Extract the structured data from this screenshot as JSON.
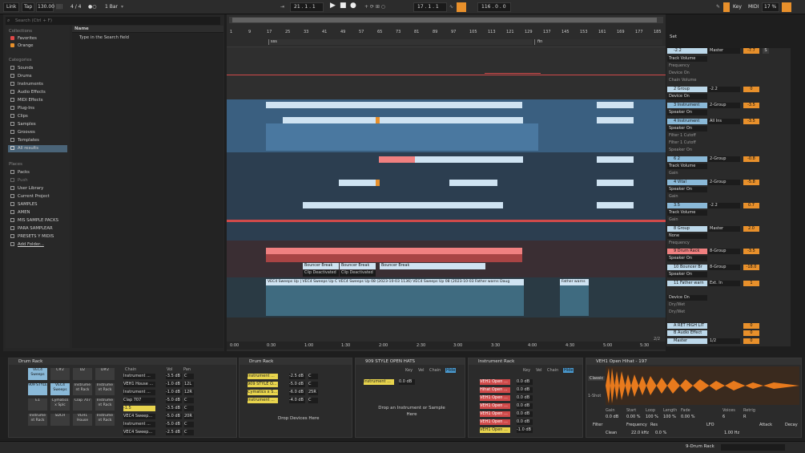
{
  "transport": {
    "link": "Link",
    "tap": "Tap",
    "tempo": "130.00",
    "signature": "4 / 4",
    "quant": "1 Bar",
    "position": "21 .  1 .  1",
    "loop_start": "17 .  1 .  1",
    "loop_len": "116 .  0 .  0",
    "key_label": "Key",
    "midi_label": "MIDI",
    "cpu": "17 %"
  },
  "browser": {
    "search_placeholder": "Search (Ctrl + F)",
    "collections_header": "Collections",
    "collections": [
      "Favorites",
      "Orange"
    ],
    "categories_header": "Categories",
    "categories": [
      "Sounds",
      "Drums",
      "Instruments",
      "Audio Effects",
      "MIDI Effects",
      "Plug-Ins",
      "Clips",
      "Samples",
      "Grooves",
      "Templates",
      "All results"
    ],
    "places_header": "Places",
    "places": [
      "Packs",
      "Push",
      "User Library",
      "Current Project",
      "SAMPLES",
      "AMEN",
      "MIS SAMPLE PACKS",
      "PARA SAMPLEAR",
      "PRESETS Y MIDIS",
      "Add Folder..."
    ],
    "name_header": "Name",
    "hint": "Type in the Search field"
  },
  "ruler": {
    "bars": [
      "1",
      "9",
      "17",
      "25",
      "33",
      "41",
      "49",
      "57",
      "65",
      "73",
      "81",
      "89",
      "97",
      "105",
      "113",
      "121",
      "129",
      "137",
      "145",
      "153",
      "161",
      "169",
      "177",
      "185"
    ],
    "time": [
      "0:00",
      "0:30",
      "1:00",
      "1:30",
      "2:00",
      "2:30",
      "3:00",
      "3:30",
      "4:00",
      "4:30",
      "5:00",
      "5:30"
    ],
    "markers": [
      "sss",
      "fin"
    ],
    "page": "2/2"
  },
  "clips": {
    "bouncer": [
      "Bouncer Break",
      "Bouncer Break",
      "Bouncer Break"
    ],
    "deactivated": [
      "Clip Deactivated",
      "Clip Deactivated"
    ],
    "vec_row": "VEC4 Sweeps Up | VEC4 Sweeps Up C VEC4 Sweeps Up 08 (2023-10-03 1136) VEC4 Sweeps Up 08 (2023-10-03 Father warns Daug",
    "father": "Father warns"
  },
  "mixer": {
    "set_label": "Set",
    "tracks": [
      {
        "name": "-2.2",
        "sel": "Master",
        "vol": "-7.7",
        "sub": [
          "Track Volume",
          "Frequency",
          "Device On",
          "Chain Volume"
        ]
      },
      {
        "name": "2 Group",
        "sel": "-2.2",
        "vol": "0",
        "sub": [
          "Device On"
        ]
      },
      {
        "name": "3 Instrument",
        "sel": "2-Group",
        "vol": "-3.5",
        "sub": [
          "Speaker On"
        ]
      },
      {
        "name": "4 Instrument",
        "sel": "All Ins",
        "vol": "-3.5",
        "sub": [
          "Speaker On",
          "Filter 1 Cutoff",
          "Filter 1 Cutoff",
          "Speaker On"
        ]
      },
      {
        "name": "6 2",
        "sel": "2-Group",
        "vol": "-0.8",
        "sub": [
          "Track Volume",
          "Gain"
        ]
      },
      {
        "name": "4 Vital",
        "sel": "2-Group",
        "vol": "-5.8",
        "sub": [
          "Speaker On",
          "Gain"
        ]
      },
      {
        "name": "3.5",
        "sel": "-2.2",
        "vol": "0.7",
        "sub": [
          "Track Volume",
          "Gain"
        ]
      },
      {
        "name": "8 Group",
        "sel": "Master",
        "vol": "2.0",
        "sub": [
          "None",
          "Frequency"
        ]
      },
      {
        "name": "9 Drum Rack",
        "sel": "8-Group",
        "vol": "-3.5",
        "sub": [
          "Speaker On"
        ]
      },
      {
        "name": "10 Bouncer Br",
        "sel": "8-Group",
        "vol": "-18.0",
        "sub": [
          "Speaker On"
        ]
      },
      {
        "name": "11 Father warn",
        "sel": "Ext. In",
        "vol": "1",
        "sub": [
          "Device On",
          "Dry/Wet",
          "Dry/Wet"
        ]
      },
      {
        "name": "A RET HIGH LIT",
        "sel": "",
        "vol": "0",
        "sub": []
      },
      {
        "name": "B Audio Effect",
        "sel": "",
        "vol": "0",
        "sub": []
      },
      {
        "name": "Master",
        "sel": "1/2",
        "vol": "0",
        "sub": []
      }
    ]
  },
  "devices": {
    "drumrack": {
      "title": "Drum Rack",
      "pads": [
        "VEC4 Sweeps",
        "C#2",
        "D2",
        "D#2",
        "909 STYLE",
        "VEC4 Sweeps",
        "Instrume nt Rack",
        "Instrume nt Rack",
        "E1",
        "Cymatics x Splc",
        "Clap 707",
        "Instrume nt Rack",
        "Instrume nt Rack",
        "SDCH",
        "VEH1 House",
        "Instrume nt Rack"
      ],
      "chain_header": "Chain",
      "vol_header": "Vol",
      "pan_header": "Pan",
      "chains": [
        {
          "name": "Instrument ...",
          "vol": "-3.5 dB",
          "pan": "C"
        },
        {
          "name": "VEH1 House ...",
          "vol": "-1.0 dB",
          "pan": "12L"
        },
        {
          "name": "Instrument ...",
          "vol": "-1.0 dB",
          "pan": "12R"
        },
        {
          "name": "Clap 707",
          "vol": "-5.0 dB",
          "pan": "C"
        },
        {
          "name": "-1.5",
          "vol": "-3.5 dB",
          "pan": "C"
        },
        {
          "name": "VEC4 Sweep...",
          "vol": "-5.0 dB",
          "pan": "20R"
        },
        {
          "name": "Instrument ...",
          "vol": "-5.0 dB",
          "pan": "C"
        },
        {
          "name": "VEC4 Sweep...",
          "vol": "-2.5 dB",
          "pan": "C"
        }
      ]
    },
    "drumrack2": {
      "title": "Drum Rack",
      "chains": [
        {
          "name": "Instrument ...",
          "vol": "-2.5 dB",
          "pan": "C"
        },
        {
          "name": "909 STYLE O...",
          "vol": "-5.0 dB",
          "pan": "C"
        },
        {
          "name": "Cymatics x S...",
          "vol": "-6.0 dB",
          "pan": "25R"
        },
        {
          "name": "Instrument ...",
          "vol": "-4.0 dB",
          "pan": "C"
        }
      ],
      "drop": "Drop Devices Here"
    },
    "hats": {
      "title": "909 STYLE OPEN HATS",
      "headers": [
        "Key",
        "Vel",
        "Chain",
        "Hide"
      ],
      "chain": "Instrument ...",
      "vol": "0.0 dB",
      "drop": "Drop an Instrument or Sample Here"
    },
    "instrack": {
      "title": "Instrument Rack",
      "headers": [
        "Key",
        "Vel",
        "Chain",
        "Hide"
      ],
      "chains": [
        "VEH1 Open ...",
        "Hihat Open ...",
        "VEH1 Open ...",
        "VEH1 Open ...",
        "VEH1 Open ...",
        "VEH1 Open ...",
        "VEH1 Open ..."
      ],
      "vols": [
        "0.0 dB",
        "0.0 dB",
        "0.0 dB",
        "0.0 dB",
        "0.0 dB",
        "0.0 dB",
        "-1.0 dB"
      ]
    },
    "sampler": {
      "title": "VEH1 Open Hihat - 197",
      "mode": "Classic",
      "shot": "1-Shot",
      "params": [
        "Gain",
        "Start",
        "Loop",
        "Length",
        "Fade",
        "Voices",
        "Retrig"
      ],
      "values": [
        "0.0 dB",
        "0.00 %",
        "100 %",
        "100 %",
        "0.00 %",
        "6",
        "R"
      ],
      "filter": "Filter",
      "freq": "Frequency",
      "res": "Res",
      "freq_val": "22.0 kHz",
      "res_val": "0.0 %",
      "lfo": "LFO",
      "lfo_val": "1.00 Hz",
      "attack": "Attack",
      "decay": "Decay",
      "clean": "Clean"
    }
  },
  "status": {
    "track": "9-Drum Rack"
  },
  "colors": {
    "accent": "#e8902b",
    "clip_blue": "#7fb3d8",
    "clip_red": "#e8616a",
    "waveform": "#e87a1d"
  }
}
